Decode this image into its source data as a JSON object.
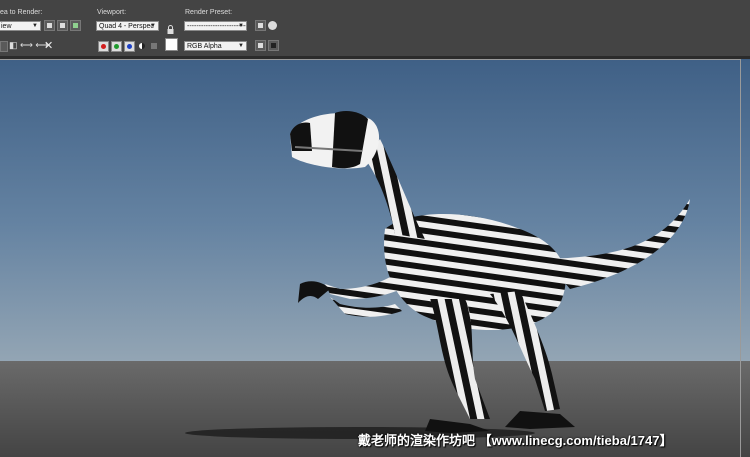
{
  "toolbar": {
    "area_to_render": {
      "label": "ea to Render:",
      "value": "iew"
    },
    "viewport": {
      "label": "Viewport:",
      "value": "Quad 4 - Perspec"
    },
    "render_preset": {
      "label": "Render Preset:",
      "value": "---------------------------"
    },
    "channel_display": {
      "value": "RGB Alpha"
    },
    "channel_colors": {
      "red": "#d11d1d",
      "green": "#1f9b2e",
      "blue": "#1c3fc4"
    }
  },
  "icons": [
    "area-crop-icon",
    "save-image-icon",
    "copy-image-icon",
    "clone-window-icon",
    "lock-icon",
    "preset-save-icon",
    "preset-settings-icon",
    "clear-icon",
    "mono-icon",
    "swatch-icon",
    "display-toggle-icon",
    "frame-icon"
  ],
  "watermark": {
    "text": "戴老师的渲染作坊吧 【www.linecg.com/tieba/1747】"
  }
}
